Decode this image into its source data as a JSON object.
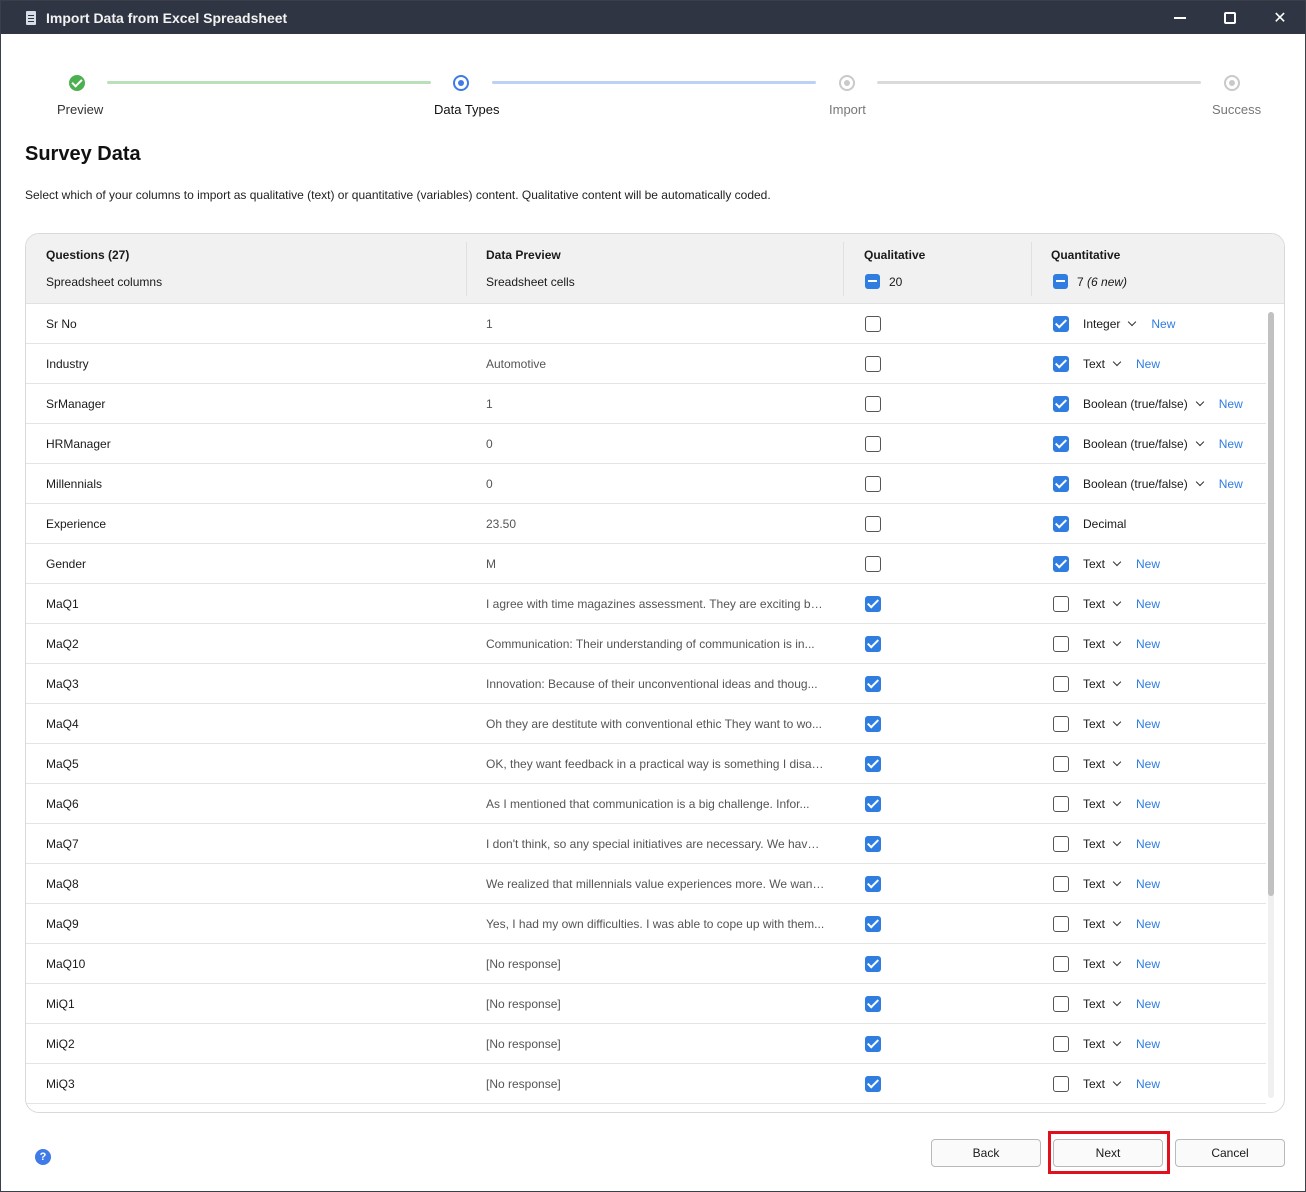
{
  "window": {
    "title": "Import Data from Excel Spreadsheet"
  },
  "steps": [
    {
      "label": "Preview",
      "state": "done"
    },
    {
      "label": "Data Types",
      "state": "active"
    },
    {
      "label": "Import",
      "state": "pending"
    },
    {
      "label": "Success",
      "state": "pending"
    }
  ],
  "page": {
    "title": "Survey Data",
    "description": "Select which of your columns to import as qualitative (text) or quantitative (variables) content. Qualitative content will be automatically coded."
  },
  "table": {
    "headers": {
      "questions": "Questions (27)",
      "questions_sub": "Spreadsheet columns",
      "preview": "Data Preview",
      "preview_sub": "Sreadsheet cells",
      "qualitative": "Qualitative",
      "qualitative_count": "20",
      "quantitative": "Quantitative",
      "quantitative_count": "7",
      "quantitative_new": "(6 new)"
    },
    "rows": [
      {
        "question": "Sr No",
        "preview": "1",
        "qualitative": false,
        "quantitative": true,
        "type": "Integer",
        "dropdown": true,
        "new": "New"
      },
      {
        "question": "Industry",
        "preview": "Automotive",
        "qualitative": false,
        "quantitative": true,
        "type": "Text",
        "dropdown": true,
        "new": "New"
      },
      {
        "question": "SrManager",
        "preview": "1",
        "qualitative": false,
        "quantitative": true,
        "type": "Boolean (true/false)",
        "dropdown": true,
        "new": "New"
      },
      {
        "question": "HRManager",
        "preview": "0",
        "qualitative": false,
        "quantitative": true,
        "type": "Boolean (true/false)",
        "dropdown": true,
        "new": "New"
      },
      {
        "question": "Millennials",
        "preview": "0",
        "qualitative": false,
        "quantitative": true,
        "type": "Boolean (true/false)",
        "dropdown": true,
        "new": "New"
      },
      {
        "question": "Experience",
        "preview": "23.50",
        "qualitative": false,
        "quantitative": true,
        "type": "Decimal",
        "dropdown": false,
        "new": ""
      },
      {
        "question": "Gender",
        "preview": "M",
        "qualitative": false,
        "quantitative": true,
        "type": "Text",
        "dropdown": true,
        "new": "New"
      },
      {
        "question": "MaQ1",
        "preview": "I agree with time magazines assessment.  They are exciting be...",
        "qualitative": true,
        "quantitative": false,
        "type": "Text",
        "dropdown": true,
        "new": "New"
      },
      {
        "question": "MaQ2",
        "preview": "Communication: Their understanding of communication is in...",
        "qualitative": true,
        "quantitative": false,
        "type": "Text",
        "dropdown": true,
        "new": "New"
      },
      {
        "question": "MaQ3",
        "preview": "Innovation: Because of their unconventional ideas and thoug...",
        "qualitative": true,
        "quantitative": false,
        "type": "Text",
        "dropdown": true,
        "new": "New"
      },
      {
        "question": "MaQ4",
        "preview": "Oh they are destitute with conventional ethic They want to wo...",
        "qualitative": true,
        "quantitative": false,
        "type": "Text",
        "dropdown": true,
        "new": "New"
      },
      {
        "question": "MaQ5",
        "preview": "OK, they want feedback in a practical way is something I disag...",
        "qualitative": true,
        "quantitative": false,
        "type": "Text",
        "dropdown": true,
        "new": "New"
      },
      {
        "question": "MaQ6",
        "preview": "As I mentioned that communication is a big challenge. Infor...",
        "qualitative": true,
        "quantitative": false,
        "type": "Text",
        "dropdown": true,
        "new": "New"
      },
      {
        "question": "MaQ7",
        "preview": "I don't think, so any special initiatives are necessary. We have t...",
        "qualitative": true,
        "quantitative": false,
        "type": "Text",
        "dropdown": true,
        "new": "New"
      },
      {
        "question": "MaQ8",
        "preview": "We realized that millennials value experiences more. We want ...",
        "qualitative": true,
        "quantitative": false,
        "type": "Text",
        "dropdown": true,
        "new": "New"
      },
      {
        "question": "MaQ9",
        "preview": "Yes, I had my own difficulties. I was able to cope up with them...",
        "qualitative": true,
        "quantitative": false,
        "type": "Text",
        "dropdown": true,
        "new": "New"
      },
      {
        "question": "MaQ10",
        "preview": "[No response]",
        "qualitative": true,
        "quantitative": false,
        "type": "Text",
        "dropdown": true,
        "new": "New"
      },
      {
        "question": "MiQ1",
        "preview": "[No response]",
        "qualitative": true,
        "quantitative": false,
        "type": "Text",
        "dropdown": true,
        "new": "New"
      },
      {
        "question": "MiQ2",
        "preview": "[No response]",
        "qualitative": true,
        "quantitative": false,
        "type": "Text",
        "dropdown": true,
        "new": "New"
      },
      {
        "question": "MiQ3",
        "preview": "[No response]",
        "qualitative": true,
        "quantitative": false,
        "type": "Text",
        "dropdown": true,
        "new": "New"
      }
    ]
  },
  "footer": {
    "help": "?",
    "back": "Back",
    "next": "Next",
    "cancel": "Cancel"
  },
  "colors": {
    "accent": "#2f7de1",
    "success": "#4caf50",
    "highlight": "#e0101e"
  }
}
